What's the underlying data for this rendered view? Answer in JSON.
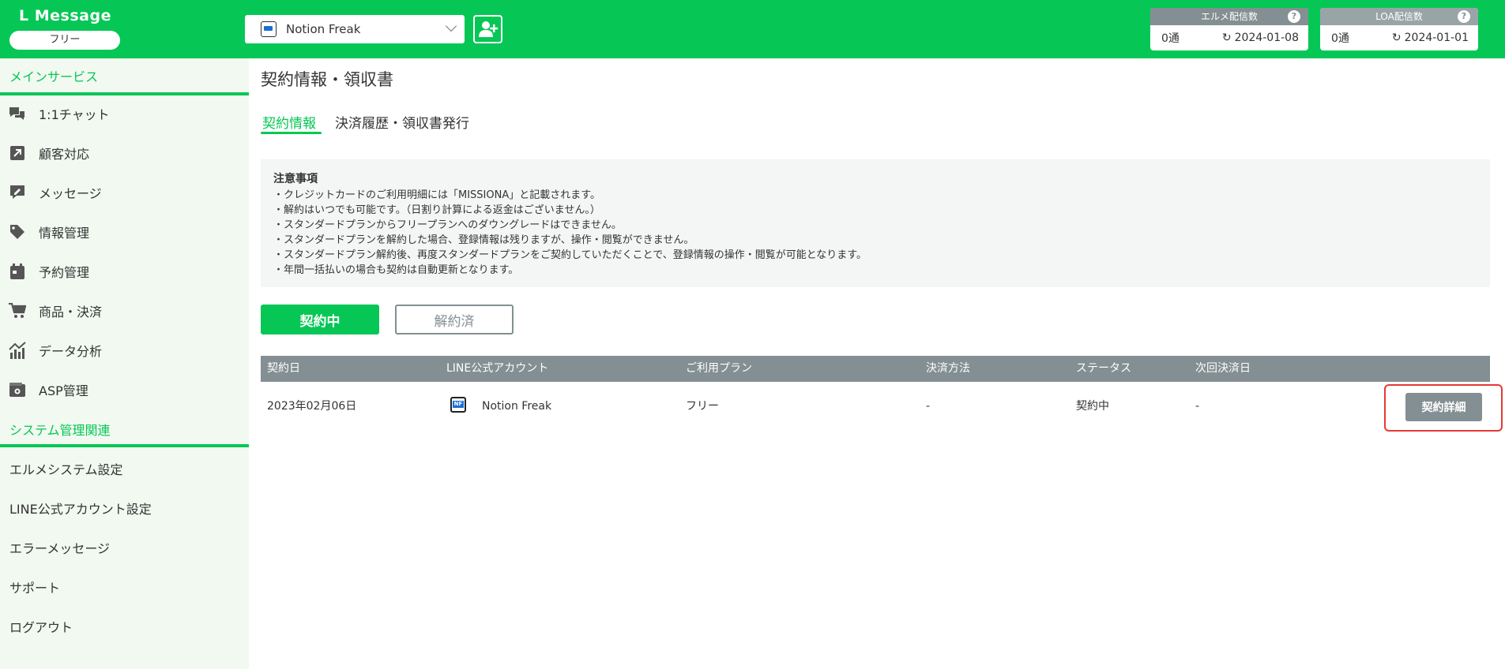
{
  "brand": {
    "title": "L Message",
    "plan": "フリー"
  },
  "header": {
    "account_name": "Notion Freak",
    "counters": [
      {
        "title": "エルメ配信数",
        "count": "0通",
        "date": "2024-01-08"
      },
      {
        "title": "LOA配信数",
        "count": "0通",
        "date": "2024-01-01"
      }
    ]
  },
  "sidebar": {
    "main_section": "メインサービス",
    "main_items": [
      {
        "label": "1:1チャット",
        "icon": "chat-icon"
      },
      {
        "label": "顧客対応",
        "icon": "arrow-up-right-icon"
      },
      {
        "label": "メッセージ",
        "icon": "message-edit-icon"
      },
      {
        "label": "情報管理",
        "icon": "tag-icon"
      },
      {
        "label": "予約管理",
        "icon": "calendar-icon"
      },
      {
        "label": "商品・決済",
        "icon": "cart-icon"
      },
      {
        "label": "データ分析",
        "icon": "chart-icon"
      },
      {
        "label": "ASP管理",
        "icon": "wallet-icon"
      }
    ],
    "system_section": "システム管理関連",
    "system_items": [
      "エルメシステム設定",
      "LINE公式アカウント設定",
      "エラーメッセージ",
      "サポート",
      "ログアウト"
    ]
  },
  "main": {
    "title": "契約情報・領収書",
    "tabs": [
      "契約情報",
      "決済履歴・領収書発行"
    ],
    "notice": {
      "title": "注意事項",
      "lines": [
        "・クレジットカードのご利用明細には「MISSIONA」と記載されます。",
        "・解約はいつでも可能です。（日割り計算による返金はございません。）",
        "・スタンダードプランからフリープランへのダウングレードはできません。",
        "・スタンダードプランを解約した場合、登録情報は残りますが、操作・閲覧ができません。",
        "・スタンダードプラン解約後、再度スタンダードプランをご契約していただくことで、登録情報の操作・閲覧が可能となります。",
        "・年間一括払いの場合も契約は自動更新となります。"
      ]
    },
    "filter": {
      "active": "契約中",
      "cancelled": "解約済"
    },
    "table": {
      "headers": [
        "契約日",
        "LINE公式アカウント",
        "ご利用プラン",
        "決済方法",
        "ステータス",
        "次回決済日"
      ],
      "row": {
        "date": "2023年02月06日",
        "account": "Notion Freak",
        "plan": "フリー",
        "payment": "-",
        "status": "契約中",
        "next_date": "-",
        "action": "契約詳細"
      }
    }
  },
  "colors": {
    "brand_green": "#06c755",
    "gray": "#848f93",
    "highlight_red": "#e53935"
  }
}
